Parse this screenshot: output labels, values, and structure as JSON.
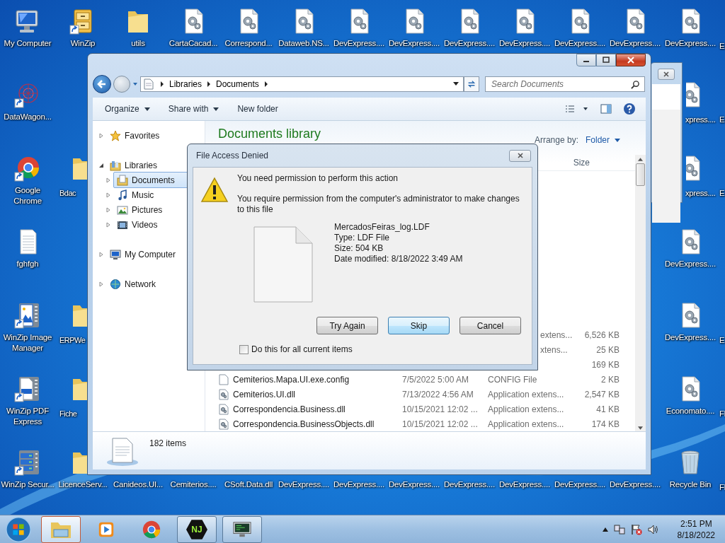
{
  "desktop": {
    "rows": [
      {
        "left": [
          {
            "label": "My Computer",
            "kind": "computer",
            "shortcut": false
          },
          {
            "label": "WinZip",
            "kind": "cabinet",
            "shortcut": true
          },
          {
            "label": "utils",
            "kind": "folder",
            "shortcut": false
          },
          {
            "label": "CartaCacad...",
            "kind": "gear-doc",
            "shortcut": false
          },
          {
            "label": "Correspond...",
            "kind": "gear-doc",
            "shortcut": false
          },
          {
            "label": "Dataweb.NS...",
            "kind": "gear-doc",
            "shortcut": false
          },
          {
            "label": "DevExpress....",
            "kind": "gear-doc",
            "shortcut": false
          },
          {
            "label": "DevExpress....",
            "kind": "gear-doc",
            "shortcut": false
          },
          {
            "label": "DevExpress....",
            "kind": "gear-doc",
            "shortcut": false
          },
          {
            "label": "DevExpress....",
            "kind": "gear-doc",
            "shortcut": false
          },
          {
            "label": "DevExpress....",
            "kind": "gear-doc",
            "shortcut": false
          },
          {
            "label": "DevExpress....",
            "kind": "gear-doc",
            "shortcut": false
          },
          {
            "label": "DevExpress....",
            "kind": "gear-doc",
            "shortcut": false
          },
          {
            "label": "E",
            "kind": "edge"
          }
        ],
        "right": []
      },
      {
        "left": [
          {
            "label": "DataWagon...",
            "kind": "graph",
            "shortcut": true
          }
        ],
        "right": [
          {
            "label": "xpress....",
            "kind": "gear-doc",
            "shortcut": false
          },
          {
            "label": "E",
            "kind": "edge"
          }
        ]
      },
      {
        "left": [
          {
            "label": "Google Chrome",
            "kind": "wheel",
            "shortcut": true
          },
          {
            "label": "Bdac",
            "kind": "folder",
            "shortcut": false
          }
        ],
        "right": [
          {
            "label": "xpress....",
            "kind": "gear-doc",
            "shortcut": false
          },
          {
            "label": "E",
            "kind": "edge"
          }
        ]
      },
      {
        "left": [
          {
            "label": "fghfgh",
            "kind": "text-doc",
            "shortcut": false
          }
        ],
        "right": [
          {
            "label": "DevExpress....",
            "kind": "gear-doc",
            "shortcut": false
          }
        ]
      },
      {
        "left": [
          {
            "label": "WinZip Image Manager",
            "kind": "image-zip",
            "shortcut": true
          },
          {
            "label": "ERPWe",
            "kind": "folder",
            "shortcut": false
          }
        ],
        "right": [
          {
            "label": "DevExpress....",
            "kind": "gear-doc",
            "shortcut": false
          },
          {
            "label": "E",
            "kind": "edge"
          }
        ]
      },
      {
        "left": [
          {
            "label": "WinZip PDF Express",
            "kind": "doc-zip",
            "shortcut": true
          },
          {
            "label": "Fiche",
            "kind": "folder",
            "shortcut": false
          }
        ],
        "right": [
          {
            "label": "Economato....",
            "kind": "gear-doc",
            "shortcut": false
          },
          {
            "label": "Fl",
            "kind": "edge"
          }
        ]
      },
      {
        "left": [
          {
            "label": "WinZip Secur...",
            "kind": "server-zip",
            "shortcut": true
          },
          {
            "label": "LicenceServ...",
            "kind": "folder",
            "shortcut": false
          },
          {
            "label": "Canideos.UI...",
            "kind": "covered"
          },
          {
            "label": "Cemiterios....",
            "kind": "covered"
          },
          {
            "label": "CSoft.Data.dll",
            "kind": "covered"
          },
          {
            "label": "DevExpress....",
            "kind": "covered"
          },
          {
            "label": "DevExpress....",
            "kind": "covered"
          },
          {
            "label": "DevExpress....",
            "kind": "covered"
          },
          {
            "label": "DevExpress....",
            "kind": "covered"
          },
          {
            "label": "DevExpress....",
            "kind": "covered"
          },
          {
            "label": "DevExpress....",
            "kind": "covered"
          },
          {
            "label": "DevExpress....",
            "kind": "covered"
          },
          {
            "label": "Recycle Bin",
            "kind": "recycle",
            "shortcut": false
          },
          {
            "label": "Fl",
            "kind": "edge"
          }
        ],
        "right": []
      }
    ]
  },
  "explorer": {
    "crumbs": [
      "Libraries",
      "Documents"
    ],
    "search": {
      "placeholder": "Search Documents"
    },
    "toolbar": [
      {
        "label": "Organize",
        "dropdown": true
      },
      {
        "label": "Share with",
        "dropdown": true
      },
      {
        "label": "New folder",
        "dropdown": false
      }
    ],
    "nav": [
      {
        "label": "Favorites",
        "kind": "star",
        "expanded": false,
        "selected": false
      },
      {
        "label": "Libraries",
        "kind": "library",
        "expanded": true,
        "selected": false,
        "children": [
          {
            "label": "Documents",
            "kind": "document",
            "expanded": false,
            "selected": true
          },
          {
            "label": "Music",
            "kind": "music",
            "expanded": false,
            "selected": false
          },
          {
            "label": "Pictures",
            "kind": "picture",
            "expanded": false,
            "selected": false
          },
          {
            "label": "Videos",
            "kind": "video",
            "expanded": false,
            "selected": false
          }
        ]
      },
      {
        "label": "My Computer",
        "kind": "computer",
        "expanded": false,
        "selected": false
      },
      {
        "label": "Network",
        "kind": "network",
        "expanded": false,
        "selected": false
      }
    ],
    "title": "Documents library",
    "arrange": {
      "label": "Arrange by:",
      "value": "Folder"
    },
    "size_header": "Size",
    "files": [
      {
        "type": "extens...",
        "size": "6,526 KB"
      },
      {
        "type": "xtens...",
        "size": "25 KB"
      },
      {
        "size": "169 KB"
      },
      {
        "kind": "blank",
        "name": "Cemiterios.Mapa.UI.exe.config",
        "date": "7/5/2022 5:00 AM",
        "type": "CONFIG File",
        "size": "2 KB"
      },
      {
        "kind": "gear",
        "name": "Cemiterios.UI.dll",
        "date": "7/13/2022 4:56 AM",
        "type": "Application extens...",
        "size": "2,547 KB"
      },
      {
        "kind": "gear",
        "name": "Correspondencia.Business.dll",
        "date": "10/15/2021 12:02 ...",
        "type": "Application extens...",
        "size": "41 KB"
      },
      {
        "kind": "gear",
        "name": "Correspondencia.BusinessObjects.dll",
        "date": "10/15/2021 12:02 ...",
        "type": "Application extens...",
        "size": "174 KB"
      }
    ],
    "status": "182 items"
  },
  "dialog": {
    "title": "File Access Denied",
    "heading": "You need permission to perform this action",
    "message": "You require permission from the computer's administrator to make changes to this file",
    "file": {
      "name": "MercadosFeiras_log.LDF",
      "details": [
        "Type: LDF File",
        "Size: 504 KB",
        "Date modified: 8/18/2022 3:49 AM"
      ]
    },
    "buttons": [
      {
        "label": "Try Again",
        "selected": false
      },
      {
        "label": "Skip",
        "selected": true
      },
      {
        "label": "Cancel",
        "selected": false
      }
    ],
    "apply_all": {
      "label": "Do this for all current items",
      "checked": false
    }
  },
  "taskbar": {
    "apps": [
      {
        "kind": "explorer",
        "open": true,
        "selected": true
      },
      {
        "kind": "player",
        "open": false,
        "selected": false
      },
      {
        "kind": "wheel",
        "open": false,
        "selected": false
      },
      {
        "kind": "hexagon",
        "open": true,
        "selected": false,
        "glyph": "NJ"
      },
      {
        "kind": "monitor",
        "open": true,
        "selected": false
      }
    ],
    "clock": {
      "time": "2:51 PM",
      "date": "8/18/2022"
    }
  }
}
